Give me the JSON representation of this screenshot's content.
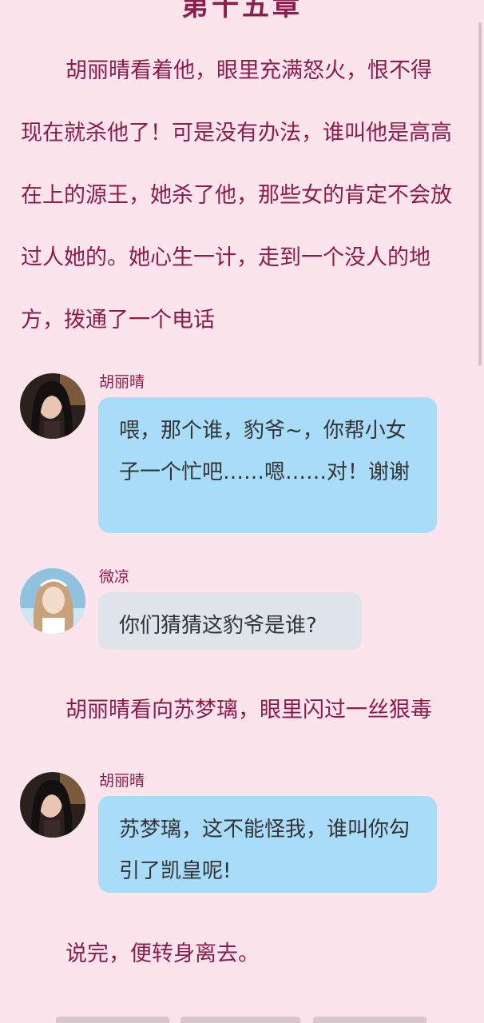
{
  "chapter": {
    "title": "第十五章"
  },
  "narration": {
    "p1": "胡丽晴看着他，眼里充满怒火，恨不得现在就杀他了！可是没有办法，谁叫他是高高在上的源王，她杀了他，那些女的肯定不会放过人她的。她心生一计，走到一个没人的地方，拨通了一个电话",
    "p2": "胡丽晴看向苏梦璃，眼里闪过一丝狠毒",
    "p3": "说完，便转身离去。"
  },
  "messages": [
    {
      "speaker": "胡丽晴",
      "text": "喂，那个谁，豹爷~，你帮小女子一个忙吧……嗯……对！谢谢",
      "avatar_icon": "girl-portrait-dark"
    },
    {
      "speaker": "微凉",
      "text": "你们猜猜这豹爷是谁?",
      "avatar_icon": "girl-portrait-light"
    },
    {
      "speaker": "胡丽晴",
      "text": "苏梦璃，这不能怪我，谁叫你勾引了凯皇呢!",
      "avatar_icon": "girl-portrait-dark"
    }
  ],
  "colors": {
    "background": "#fbe4ec",
    "narration_text": "#8c1d4a",
    "bubble_blue": "#a8dcf8",
    "bubble_grey": "#dfe3ea"
  }
}
